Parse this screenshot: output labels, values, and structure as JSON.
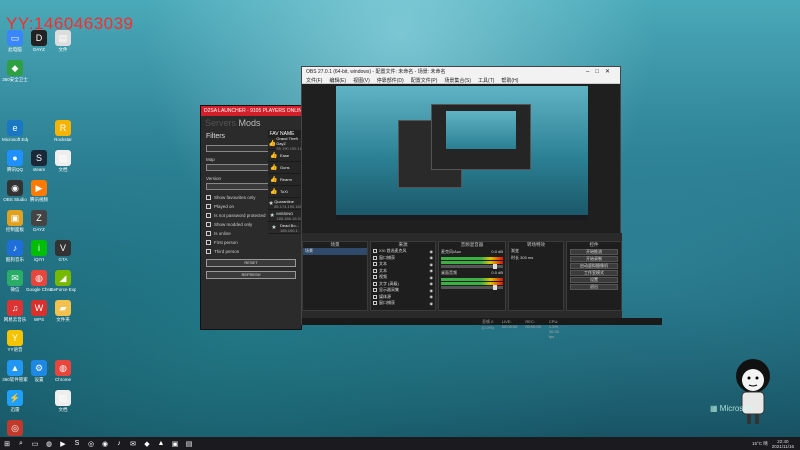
{
  "watermark": "YY:1460463039",
  "desktop_icons": [
    {
      "label": "此电脑",
      "color": "#3a86ff",
      "glyph": "▭",
      "col": 0,
      "row": 0
    },
    {
      "label": "360安全卫士",
      "color": "#2ea043",
      "glyph": "◆",
      "col": 0,
      "row": 1
    },
    {
      "label": "Microsoft Edge",
      "color": "#1a78c2",
      "glyph": "e",
      "col": 0,
      "row": 3
    },
    {
      "label": "腾讯QQ",
      "color": "#1e90ff",
      "glyph": "●",
      "col": 0,
      "row": 4
    },
    {
      "label": "OBS Studio",
      "color": "#333",
      "glyph": "◉",
      "col": 0,
      "row": 5
    },
    {
      "label": "控制面板",
      "color": "#e0a020",
      "glyph": "▣",
      "col": 0,
      "row": 6
    },
    {
      "label": "酷狗音乐",
      "color": "#1e6fd9",
      "glyph": "♪",
      "col": 0,
      "row": 7
    },
    {
      "label": "微信",
      "color": "#2aae67",
      "glyph": "✉",
      "col": 0,
      "row": 8
    },
    {
      "label": "网易云音乐",
      "color": "#d33",
      "glyph": "♫",
      "col": 0,
      "row": 9
    },
    {
      "label": "YY语音",
      "color": "#f5c400",
      "glyph": "Y",
      "col": 0,
      "row": 10
    },
    {
      "label": "360软件管家",
      "color": "#2196f3",
      "glyph": "▲",
      "col": 0,
      "row": 11
    },
    {
      "label": "迅雷",
      "color": "#1ea0ff",
      "glyph": "⚡",
      "col": 0,
      "row": 12
    },
    {
      "label": "网易",
      "color": "#c0392b",
      "glyph": "◎",
      "col": 0,
      "row": 13
    },
    {
      "label": "DAYZ",
      "color": "#222",
      "glyph": "D",
      "col": 1,
      "row": 0
    },
    {
      "label": "steam",
      "color": "#1b2838",
      "glyph": "S",
      "col": 1,
      "row": 4
    },
    {
      "label": "腾讯视频",
      "color": "#ff7a00",
      "glyph": "▶",
      "col": 1,
      "row": 5
    },
    {
      "label": "DAYZ",
      "color": "#444",
      "glyph": "Z",
      "col": 1,
      "row": 6
    },
    {
      "label": "iQIYI",
      "color": "#00be06",
      "glyph": "i",
      "col": 1,
      "row": 7
    },
    {
      "label": "Google Chrome",
      "color": "#e8453c",
      "glyph": "◍",
      "col": 1,
      "row": 8
    },
    {
      "label": "WPS",
      "color": "#d9302c",
      "glyph": "W",
      "col": 1,
      "row": 9
    },
    {
      "label": "设置",
      "color": "#1e88e5",
      "glyph": "⚙",
      "col": 1,
      "row": 11
    },
    {
      "label": "文件",
      "color": "#ddd",
      "glyph": "▤",
      "col": 2,
      "row": 0
    },
    {
      "label": "Rockstar",
      "color": "#f4b400",
      "glyph": "R",
      "col": 2,
      "row": 3
    },
    {
      "label": "文档",
      "color": "#eee",
      "glyph": "▤",
      "col": 2,
      "row": 4
    },
    {
      "label": "GTA",
      "color": "#333",
      "glyph": "V",
      "col": 2,
      "row": 7
    },
    {
      "label": "GeForce Experience",
      "color": "#76b900",
      "glyph": "◢",
      "col": 2,
      "row": 8
    },
    {
      "label": "文件夹",
      "color": "#f2c14e",
      "glyph": "▰",
      "col": 2,
      "row": 9
    },
    {
      "label": "Chrome",
      "color": "#e8453c",
      "glyph": "◍",
      "col": 2,
      "row": 11
    },
    {
      "label": "文档",
      "color": "#eee",
      "glyph": "▤",
      "col": 2,
      "row": 12
    }
  ],
  "launcher": {
    "title": "D2SA LAUNCHER - 9105 PLAYERS ONLINE",
    "tab_servers": "Servers",
    "tab_mods": "Mods",
    "filters_heading": "Filters",
    "map_label": "Map",
    "version_label": "Version",
    "checkboxes": [
      "Show favourites only",
      "Played on",
      "Is not password protected",
      "Show modded only",
      "Is online",
      "First person",
      "Third person"
    ],
    "reset_label": "RESET",
    "refresh_label": "REFRESH",
    "col_fav": "FAV",
    "col_name": "NAME",
    "servers": [
      {
        "name": "Grand Theft DayZ",
        "ip": "85.190.155.18"
      },
      {
        "name": "Ease",
        "ip": ""
      },
      {
        "name": "Guns",
        "ip": ""
      },
      {
        "name": "Rearm",
        "ip": ""
      },
      {
        "name": "ToXi",
        "ip": ""
      },
      {
        "name": "Quarantine",
        "ip": "85.174.190.165"
      },
      {
        "name": "MISSING",
        "ip": "185.186.19.34"
      },
      {
        "name": "Dead Bo...",
        "ip": "185.190.1"
      }
    ]
  },
  "obs": {
    "title": "OBS 27.0.1 (64-bit, windows) - 配置文件: 未命名 - 场景: 未命名",
    "menu": [
      "文件(F)",
      "编辑(E)",
      "视图(V)",
      "停靠部件(D)",
      "配置文件(P)",
      "场景集合(S)",
      "工具(T)",
      "帮助(H)"
    ],
    "docks": {
      "scenes": "场景",
      "sources": "来源",
      "mixer": "音频混音器",
      "transitions": "转场特效",
      "controls": "控件"
    },
    "scene_item": "场景",
    "sources_list": [
      "XXI 首选麦克风",
      "窗口捕获",
      "文本",
      "文本",
      "视频",
      "文字 (高级)",
      "显示器采集",
      "媒体源",
      "窗口捕获"
    ],
    "mixer_items": [
      {
        "name": "麦克风/Aux",
        "db": "0.0 dB"
      },
      {
        "name": "桌面音频",
        "db": "0.0 dB"
      }
    ],
    "transition_label": "渐变",
    "duration_label": "时长",
    "duration_value": "300 ms",
    "controls_buttons": [
      "开始推流",
      "开始录制",
      "启动虚拟摄像机",
      "工作室模式",
      "设置",
      "退出"
    ],
    "status": [
      "丢帧 0 (0.0%)",
      "LIVE: 00:00:00",
      "REC: 00:00:00",
      "CPU: 1.5%, 30.00 fps"
    ]
  },
  "taskbar": {
    "items": [
      "⊞",
      "⌕",
      "▭",
      "◍",
      "▶",
      "S",
      "◎",
      "◉",
      "♪",
      "✉",
      "◆",
      "▲",
      "▣",
      "▤"
    ],
    "weather": "15°C 晴",
    "time": "22:40",
    "date": "2021/11/16"
  },
  "ms_logo_text": "Microsoft"
}
